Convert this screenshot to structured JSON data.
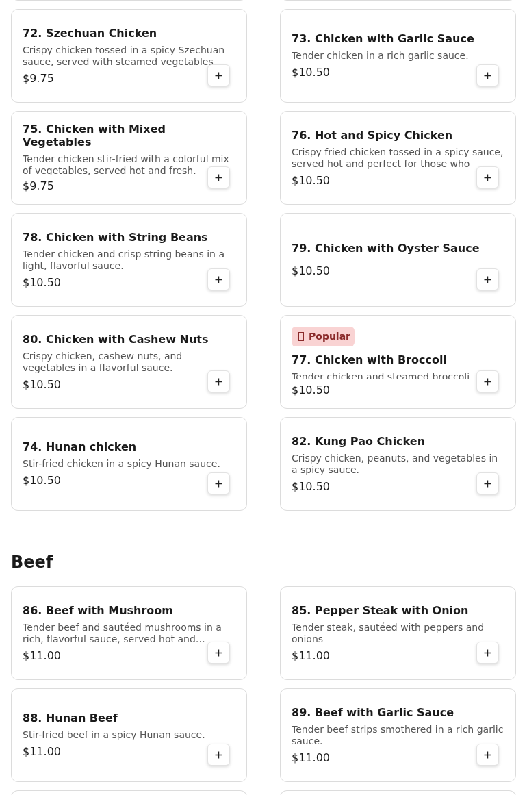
{
  "sections": [
    {
      "cut_cards_above": true,
      "items": [
        {
          "name": "72. Szechuan Chicken",
          "description": "Crispy chicken tossed in a spicy Szechuan sauce, served with steamed vegetables",
          "price": "$9.75"
        },
        {
          "name": "73. Chicken with Garlic Sauce",
          "description": "Tender chicken in a rich garlic sauce.",
          "price": "$10.50"
        },
        {
          "name": "75. Chicken with Mixed Vegetables",
          "description": "Tender chicken stir-fried with a colorful mix of vegetables, served hot and fresh.",
          "price": "$9.75"
        },
        {
          "name": "76. Hot and Spicy Chicken",
          "description": "Crispy fried chicken tossed in a spicy sauce, served hot and perfect for those who",
          "price": "$10.50"
        },
        {
          "name": "78. Chicken with String Beans",
          "description": "Tender chicken and crisp string beans in a light, flavorful sauce.",
          "price": "$10.50"
        },
        {
          "name": "79. Chicken with Oyster Sauce",
          "price": "$10.50"
        },
        {
          "name": "80. Chicken with Cashew Nuts",
          "description": "Crispy chicken, cashew nuts, and vegetables in a flavorful sauce.",
          "price": "$10.50"
        },
        {
          "name": "77. Chicken with Broccoli",
          "description": "Tender chicken and steamed broccoli",
          "price": "$10.50",
          "badge": "Popular"
        },
        {
          "name": "74. Hunan chicken",
          "description": "Stir-fried chicken in a spicy Hunan sauce.",
          "price": "$10.50"
        },
        {
          "name": "82. Kung Pao Chicken",
          "description": "Crispy chicken, peanuts, and vegetables in a spicy sauce.",
          "price": "$10.50"
        }
      ]
    },
    {
      "title": "Beef",
      "cut_cards_below": true,
      "items": [
        {
          "name": "86. Beef with Mushroom",
          "description": "Tender beef and sautéed mushrooms in a rich, flavorful sauce, served hot and…",
          "price": "$11.00"
        },
        {
          "name": "85. Pepper Steak with Onion",
          "description": "Tender steak, sautéed with peppers and onions",
          "price": "$11.00"
        },
        {
          "name": "88. Hunan Beef",
          "description": "Stir-fried beef in a spicy Hunan sauce.",
          "price": "$11.00"
        },
        {
          "name": "89. Beef with Garlic Sauce",
          "description": "Tender beef strips smothered in a rich garlic sauce.",
          "price": "$11.00"
        }
      ]
    }
  ]
}
